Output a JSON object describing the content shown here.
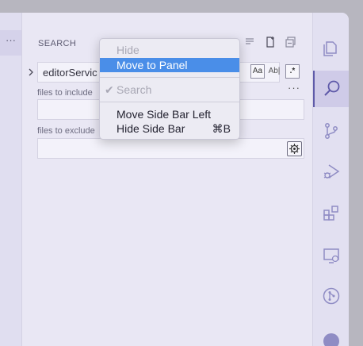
{
  "sidebar": {
    "title": "SEARCH",
    "search_value": "editorServic",
    "files_to_include_label": "files to include",
    "files_to_exclude_label": "files to exclude",
    "options": {
      "match_case": "Aa",
      "whole_word": "Ab|",
      "regex": ".*"
    },
    "more_label": "···"
  },
  "left_strip": {
    "label": "···"
  },
  "context_menu": {
    "items": [
      {
        "label": "Hide",
        "state": "disabled"
      },
      {
        "label": "Move to Panel",
        "state": "highlighted"
      },
      {
        "label": "Search",
        "state": "disabled-checked"
      },
      {
        "label": "Move Side Bar Left",
        "state": "normal"
      },
      {
        "label": "Hide Side Bar",
        "shortcut": "⌘B",
        "state": "normal"
      }
    ],
    "check_glyph": "✔"
  },
  "activity_bar": {
    "items": [
      "explorer-icon",
      "search-icon",
      "source-control-icon",
      "run-debug-icon",
      "extensions-icon",
      "remote-explorer-icon",
      "pull-requests-icon",
      "github-icon"
    ],
    "active": "search-icon",
    "accent_color": "#5f5aa9"
  }
}
